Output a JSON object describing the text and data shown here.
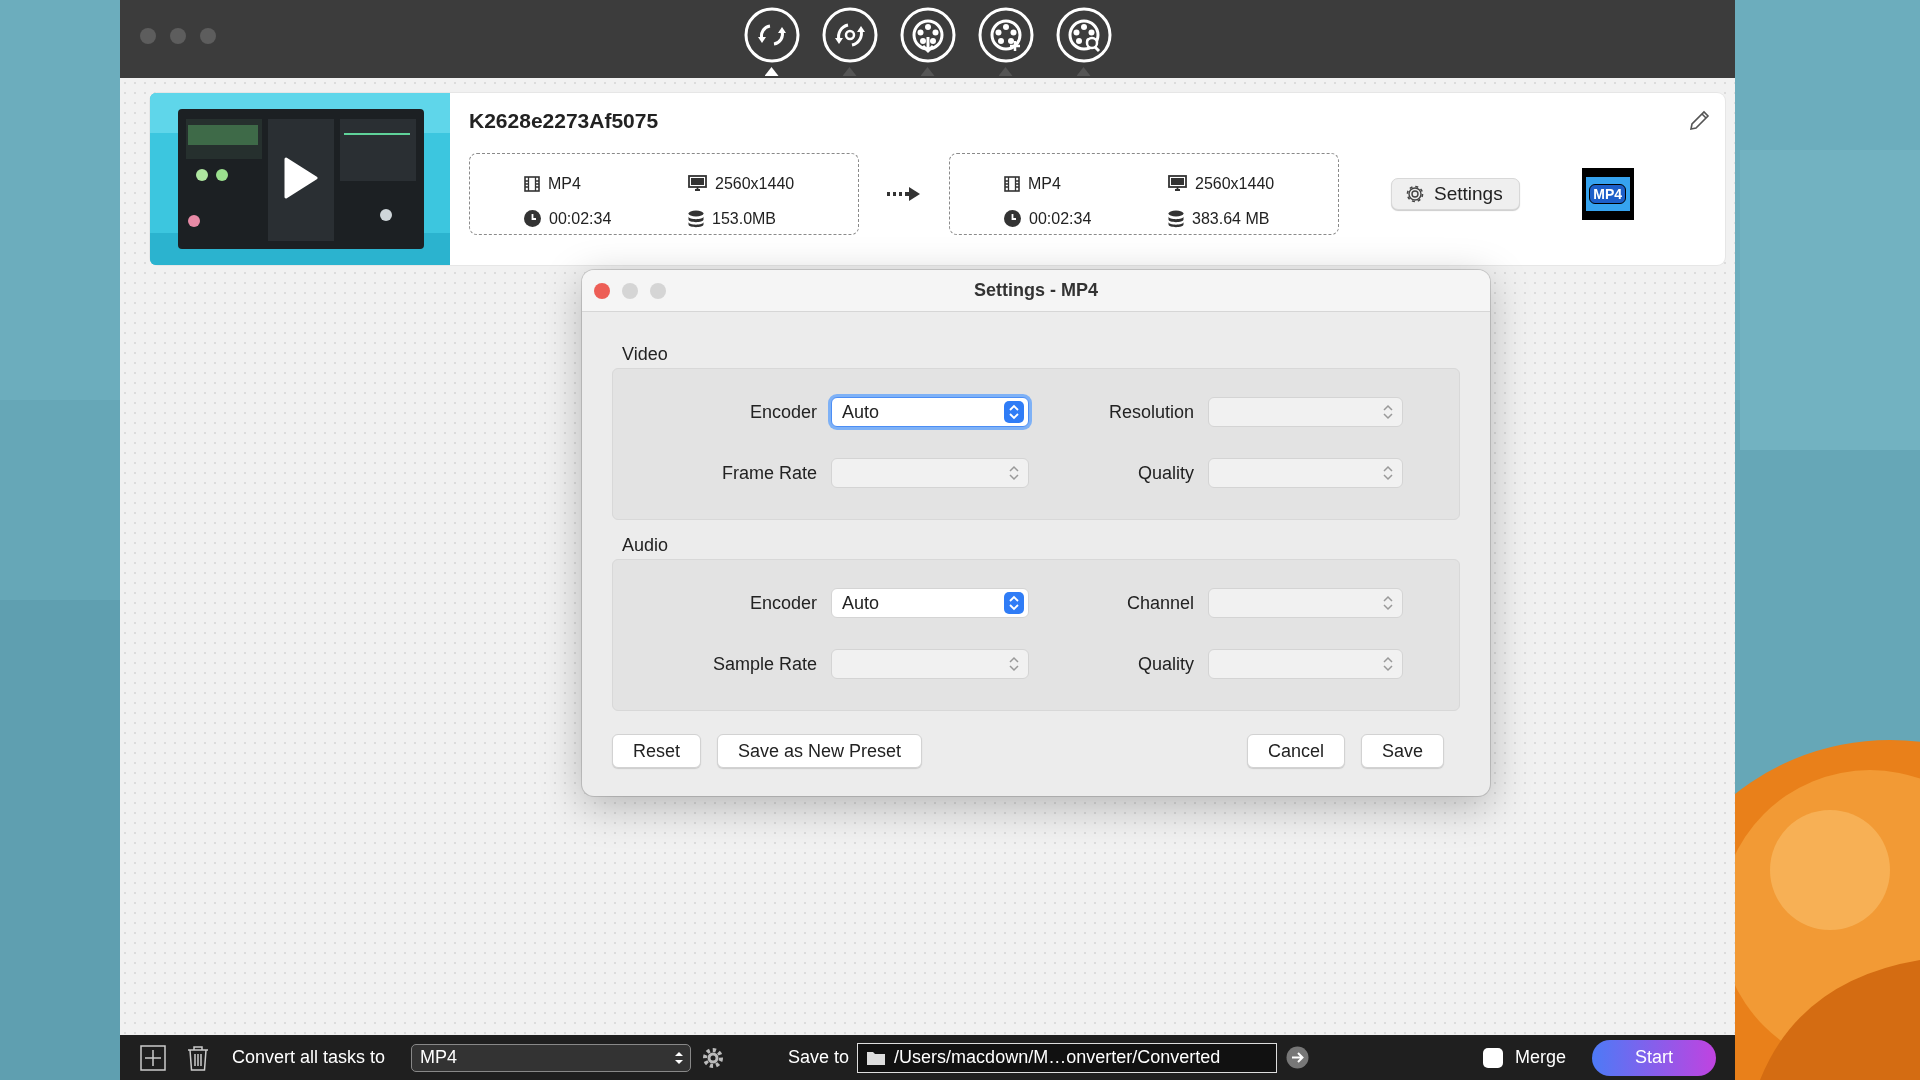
{
  "toolbar": [
    {
      "kind": "convert",
      "selected": true
    },
    {
      "kind": "compress",
      "selected": false
    },
    {
      "kind": "download",
      "selected": false
    },
    {
      "kind": "merge",
      "selected": false
    },
    {
      "kind": "search",
      "selected": false
    }
  ],
  "task": {
    "name": "K2628e2273Af5075",
    "source": {
      "format": "MP4",
      "resolution": "2560x1440",
      "duration": "00:02:34",
      "size": "153.0MB"
    },
    "target": {
      "format": "MP4",
      "resolution": "2560x1440",
      "duration": "00:02:34",
      "size": "383.64 MB"
    },
    "settings_button": "Settings",
    "format_badge": "MP4"
  },
  "dialog": {
    "title": "Settings - MP4",
    "sections": [
      {
        "title": "Video",
        "fields": [
          {
            "label": "Encoder",
            "value": "Auto",
            "focused": true
          },
          {
            "label": "Resolution",
            "focused": false
          },
          {
            "label": "Frame Rate",
            "focused": false
          },
          {
            "label": "Quality",
            "focused": false
          }
        ]
      },
      {
        "title": "Audio",
        "fields": [
          {
            "label": "Encoder",
            "value": "Auto",
            "focused": false
          },
          {
            "label": "Channel",
            "focused": false
          },
          {
            "label": "Sample Rate",
            "focused": false
          },
          {
            "label": "Quality",
            "focused": false
          }
        ]
      }
    ],
    "buttons": [
      {
        "label": "Reset",
        "kind": "leading"
      },
      {
        "label": "Save as New Preset",
        "kind": "leading"
      },
      {
        "label": "Cancel",
        "kind": "trailing"
      },
      {
        "label": "Save",
        "kind": "trailing"
      }
    ]
  },
  "bottom_bar": {
    "convert_label": "Convert all tasks to",
    "format": "MP4",
    "save_label": "Save to",
    "path": "/Users/macdown/M…onverter/Converted",
    "merge": {
      "label": "Merge",
      "checked": false
    },
    "start_button": "Start"
  }
}
